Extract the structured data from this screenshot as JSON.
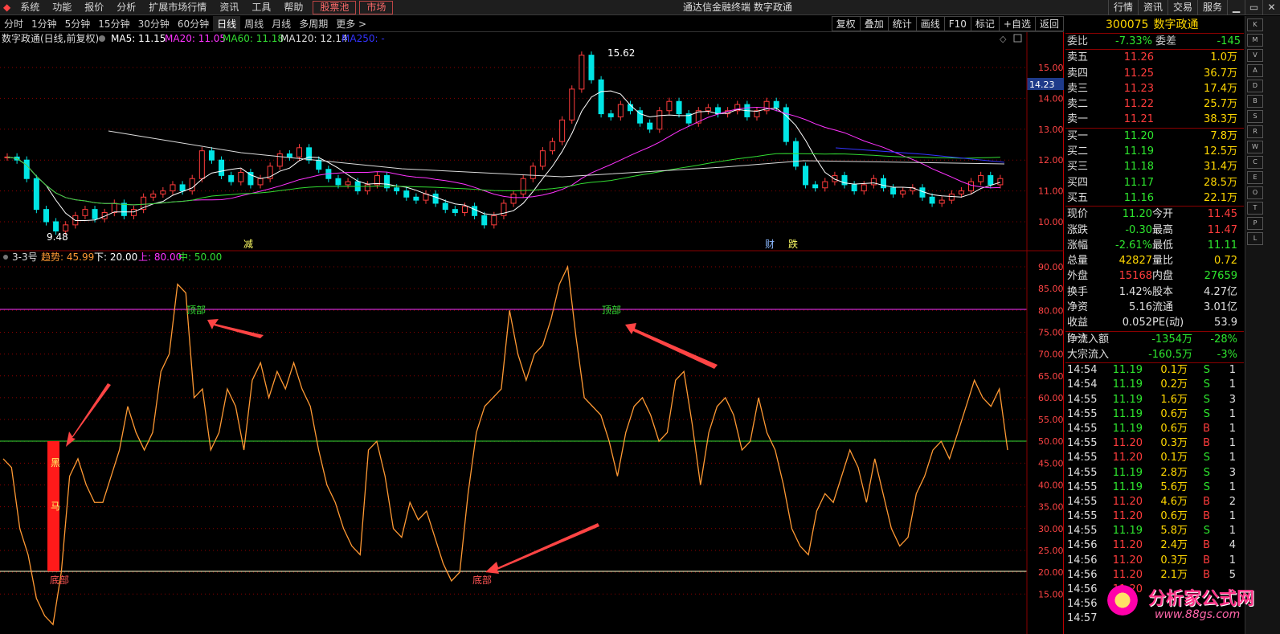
{
  "menubar": {
    "items": [
      "系统",
      "功能",
      "报价",
      "分析",
      "扩展市场行情",
      "资讯",
      "工具",
      "帮助"
    ],
    "boxed": [
      "股票池",
      "市场"
    ],
    "title": "通达信金融终端  数字政通",
    "right_buttons": [
      "行情",
      "资讯",
      "交易",
      "服务"
    ]
  },
  "periodbar": {
    "periods": [
      "分时",
      "1分钟",
      "5分钟",
      "15分钟",
      "30分钟",
      "60分钟",
      "日线",
      "周线",
      "月线",
      "多周期",
      "更多 >"
    ],
    "active": "日线",
    "tools": [
      "复权",
      "叠加",
      "统计",
      "画线",
      "F10",
      "标记",
      "+自选",
      "返回"
    ]
  },
  "price_panel": {
    "label": "数字政通(日线,前复权)",
    "ma": [
      {
        "text": "MA5: 11.15",
        "color": "#ffffff"
      },
      {
        "text": "MA20: 11.05",
        "color": "#ff33ff"
      },
      {
        "text": "MA60: 11.18",
        "color": "#33dd33"
      },
      {
        "text": "MA120: 12.14",
        "color": "#dddddd"
      },
      {
        "text": "MA250: -",
        "color": "#3333ff"
      }
    ],
    "high_label": "15.62",
    "low_label": "9.48",
    "current_price_tag": "14.23",
    "yticks": [
      "15.00",
      "14.00",
      "13.00",
      "12.00",
      "11.00",
      "10.00"
    ],
    "markers": [
      "减",
      "财",
      "跌"
    ]
  },
  "indicator_panel": {
    "label": "3-3号",
    "params": [
      {
        "text": "趋势: 45.99",
        "color": "#ff9933"
      },
      {
        "text": "下: 20.00",
        "color": "#ffffff"
      },
      {
        "text": "上: 80.00",
        "color": "#ff33ff"
      },
      {
        "text": "中: 50.00",
        "color": "#33dd33"
      }
    ],
    "yticks": [
      "90.00",
      "85.00",
      "80.00",
      "75.00",
      "70.00",
      "65.00",
      "60.00",
      "55.00",
      "50.00",
      "45.00",
      "40.00",
      "35.00",
      "30.00",
      "25.00",
      "20.00",
      "15.00"
    ],
    "annotations": {
      "top": "顶部",
      "bottom": "底部",
      "black1": "黑",
      "black2": "马"
    }
  },
  "chart_data": {
    "type": "line",
    "title": "3-3号",
    "ylim": [
      12,
      92
    ],
    "series": [
      {
        "name": "趋势",
        "values": [
          46,
          44,
          30,
          24,
          14,
          10,
          8,
          20,
          42,
          46,
          40,
          36,
          36,
          42,
          48,
          58,
          52,
          48,
          52,
          66,
          70,
          86,
          84,
          60,
          62,
          48,
          52,
          62,
          58,
          48,
          64,
          68,
          60,
          66,
          62,
          68,
          62,
          58,
          48,
          40,
          36,
          30,
          26,
          24,
          48,
          50,
          42,
          30,
          28,
          36,
          32,
          34,
          28,
          22,
          18,
          20,
          38,
          52,
          58,
          60,
          62,
          80,
          70,
          64,
          70,
          72,
          78,
          86,
          90,
          74,
          60,
          58,
          56,
          50,
          42,
          52,
          58,
          60,
          56,
          50,
          52,
          64,
          66,
          54,
          40,
          52,
          58,
          60,
          56,
          48,
          50,
          60,
          52,
          48,
          40,
          30,
          26,
          24,
          34,
          38,
          36,
          42,
          48,
          44,
          36,
          46,
          38,
          30,
          26,
          28,
          38,
          42,
          48,
          50,
          46,
          52,
          58,
          64,
          60,
          58,
          62,
          48
        ],
        "color": "#ff9933"
      }
    ]
  },
  "quote": {
    "code": "300075",
    "name": "数字政通",
    "webi": {
      "label": "委比",
      "value": "-7.33%",
      "diff_label": "委差",
      "diff": "-145"
    },
    "asks": [
      {
        "label": "卖五",
        "price": "11.26",
        "vol": "1.0万"
      },
      {
        "label": "卖四",
        "price": "11.25",
        "vol": "36.7万"
      },
      {
        "label": "卖三",
        "price": "11.23",
        "vol": "17.4万"
      },
      {
        "label": "卖二",
        "price": "11.22",
        "vol": "25.7万"
      },
      {
        "label": "卖一",
        "price": "11.21",
        "vol": "38.3万"
      }
    ],
    "bids": [
      {
        "label": "买一",
        "price": "11.20",
        "vol": "7.8万"
      },
      {
        "label": "买二",
        "price": "11.19",
        "vol": "12.5万"
      },
      {
        "label": "买三",
        "price": "11.18",
        "vol": "31.4万"
      },
      {
        "label": "买四",
        "price": "11.17",
        "vol": "28.5万"
      },
      {
        "label": "买五",
        "price": "11.16",
        "vol": "22.1万"
      }
    ],
    "stats": [
      {
        "l1": "现价",
        "v1": "11.20",
        "c1": "green",
        "l2": "今开",
        "v2": "11.45",
        "c2": "red"
      },
      {
        "l1": "涨跌",
        "v1": "-0.30",
        "c1": "green",
        "l2": "最高",
        "v2": "11.47",
        "c2": "red"
      },
      {
        "l1": "涨幅",
        "v1": "-2.61%",
        "c1": "green",
        "l2": "最低",
        "v2": "11.11",
        "c2": "green"
      },
      {
        "l1": "总量",
        "v1": "42827",
        "c1": "yellow",
        "l2": "量比",
        "v2": "0.72",
        "c2": "yellow"
      },
      {
        "l1": "外盘",
        "v1": "15168",
        "c1": "red",
        "l2": "内盘",
        "v2": "27659",
        "c2": "green"
      },
      {
        "l1": "换手",
        "v1": "1.42%",
        "c1": "white",
        "l2": "股本",
        "v2": "4.27亿",
        "c2": "white"
      },
      {
        "l1": "净资",
        "v1": "5.16",
        "c1": "white",
        "l2": "流通",
        "v2": "3.01亿",
        "c2": "white"
      },
      {
        "l1": "收益(一)",
        "v1": "0.052",
        "c1": "white",
        "l2": "PE(动)",
        "v2": "53.9",
        "c2": "white"
      }
    ],
    "flows": [
      {
        "label": "净流入额",
        "value": "-1354万",
        "pct": "-28%"
      },
      {
        "label": "大宗流入",
        "value": "-160.5万",
        "pct": "-3%"
      }
    ],
    "ticks": [
      [
        "14:54",
        "11.19",
        "0.1万",
        "S",
        "1"
      ],
      [
        "14:54",
        "11.19",
        "0.2万",
        "S",
        "1"
      ],
      [
        "14:55",
        "11.19",
        "1.6万",
        "S",
        "3"
      ],
      [
        "14:55",
        "11.19",
        "0.6万",
        "S",
        "1"
      ],
      [
        "14:55",
        "11.19",
        "0.6万",
        "B",
        "1"
      ],
      [
        "14:55",
        "11.20",
        "0.3万",
        "B",
        "1"
      ],
      [
        "14:55",
        "11.20",
        "0.1万",
        "S",
        "1"
      ],
      [
        "14:55",
        "11.19",
        "2.8万",
        "S",
        "3"
      ],
      [
        "14:55",
        "11.19",
        "5.6万",
        "S",
        "1"
      ],
      [
        "14:55",
        "11.20",
        "4.6万",
        "B",
        "2"
      ],
      [
        "14:55",
        "11.20",
        "0.6万",
        "B",
        "1"
      ],
      [
        "14:55",
        "11.19",
        "5.8万",
        "S",
        "1"
      ],
      [
        "14:56",
        "11.20",
        "2.4万",
        "B",
        "4"
      ],
      [
        "14:56",
        "11.20",
        "0.3万",
        "B",
        "1"
      ],
      [
        "14:56",
        "11.20",
        "2.1万",
        "B",
        "5"
      ],
      [
        "14:56",
        "11.20",
        "",
        ".",
        ""
      ],
      [
        "14:56",
        "",
        "",
        "",
        ""
      ],
      [
        "14:57",
        "",
        "",
        "",
        ""
      ]
    ]
  },
  "watermark": {
    "title": "分析家公式网",
    "url": "www.88gs.com"
  },
  "sidebar_icons": [
    "K",
    "M",
    "V",
    "A",
    "D",
    "B",
    "S",
    "R",
    "W",
    "C",
    "E",
    "O",
    "T",
    "P",
    "L"
  ],
  "colors": {
    "up": "#ff3c3c",
    "down": "#00e5e5",
    "ma5": "#ffffff",
    "ma20": "#ff33ff",
    "ma60": "#33dd33",
    "ma120": "#dddddd",
    "ma250": "#3333ff",
    "trend": "#ff9933"
  }
}
